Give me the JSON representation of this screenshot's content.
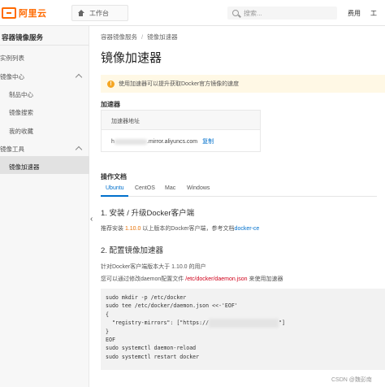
{
  "topbar": {
    "brand": "阿里云",
    "workbench_label": "工作台",
    "search_placeholder": "搜索...",
    "expense_label": "费用",
    "avatar_label": "工"
  },
  "sidebar": {
    "title": "容器镜像服务",
    "items": [
      {
        "label": "实例列表"
      },
      {
        "label": "镜像中心"
      },
      {
        "label": "制品中心"
      },
      {
        "label": "镜像搜索"
      },
      {
        "label": "我的收藏"
      },
      {
        "label": "镜像工具"
      },
      {
        "label": "镜像加速器"
      }
    ]
  },
  "breadcrumb": {
    "root": "容器镜像服务",
    "separator": "/",
    "current": "镜像加速器"
  },
  "page": {
    "title": "镜像加速器",
    "notice": "使用加速器可以提升获取Docker官方镜像的速度",
    "accelerator_section": "加速器",
    "accelerator_header": "加速器地址",
    "accelerator_url_prefix": "h",
    "accelerator_url_suffix": ".mirror.aliyuncs.com",
    "copy_label": "复制",
    "docs_section": "操作文档",
    "tabs": [
      "Ubuntu",
      "CentOS",
      "Mac",
      "Windows"
    ],
    "step1_title": "1. 安装 / 升级Docker客户端",
    "step1_text_a": "推荐安装 ",
    "step1_version": "1.10.0",
    "step1_text_b": " 以上版本的Docker客户端，参考文档",
    "step1_link": "docker-ce",
    "step2_title": "2. 配置镜像加速器",
    "step2_text1": "针对Docker客户端版本大于 1.10.0 的用户",
    "step2_text2_a": "您可以通过修改daemon配置文件 ",
    "step2_path": "/etc/docker/daemon.json",
    "step2_text2_b": " 来使用加速器",
    "code_lines": [
      "sudo mkdir -p /etc/docker",
      "sudo tee /etc/docker/daemon.json <<-'EOF'",
      "{",
      "  \"registry-mirrors\": [\"https://",
      "}",
      "EOF",
      "sudo systemctl daemon-reload",
      "sudo systemctl restart docker"
    ],
    "code_mirror_tail": "\"]"
  },
  "watermark": "CSDN @魏彭南"
}
